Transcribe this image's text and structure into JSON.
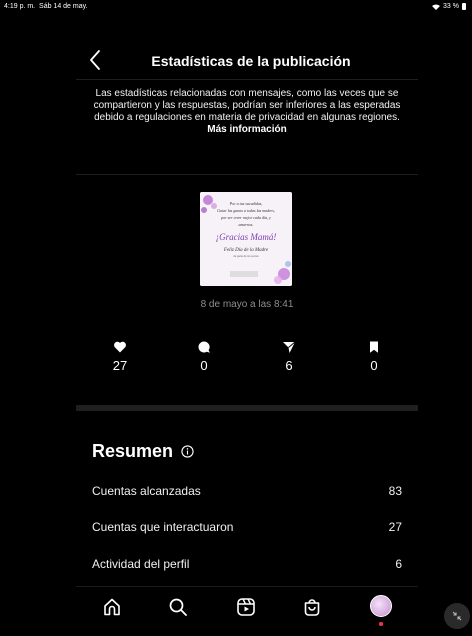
{
  "status_bar": {
    "time": "4:19 p. m.",
    "date": "Sáb 14 de may.",
    "battery": "33 %"
  },
  "header": {
    "title": "Estadísticas de la publicación"
  },
  "notice": {
    "text": "Las estadísticas relacionadas con mensajes, como las veces que se compartieron y las respuestas, podrían ser inferiores a las esperadas debido a regulaciones en materia de privacidad en algunas regiones. ",
    "more": "Más información"
  },
  "post": {
    "image_lines": [
      "Por a tus sacudidas,",
      "Guiar las ganas a todas las madres,",
      "por ser creer mejor cada día, y",
      "amarnos.",
      "¡Gracias Mamá!",
      "Feliz Día de la Madre",
      "de parte de los socios"
    ],
    "date": "8 de mayo a las 8:41"
  },
  "stats": [
    {
      "icon": "heart-icon",
      "value": "27"
    },
    {
      "icon": "comment-icon",
      "value": "0"
    },
    {
      "icon": "share-icon",
      "value": "6"
    },
    {
      "icon": "save-icon",
      "value": "0"
    }
  ],
  "summary": {
    "title": "Resumen",
    "rows": [
      {
        "label": "Cuentas alcanzadas",
        "value": "83"
      },
      {
        "label": "Cuentas que interactuaron",
        "value": "27"
      },
      {
        "label": "Actividad del perfil",
        "value": "6"
      }
    ]
  },
  "nav": [
    "home-icon",
    "search-icon",
    "reels-icon",
    "shop-icon",
    "profile-avatar"
  ],
  "colors": {
    "background": "#000000",
    "muted": "#8e8e8e",
    "accent_dot": "#ff2d55"
  }
}
